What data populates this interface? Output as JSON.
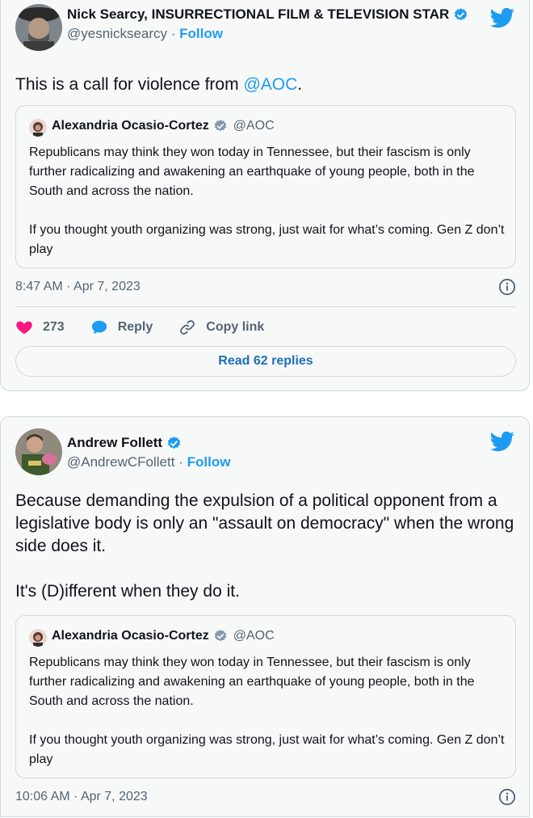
{
  "tweets": [
    {
      "author": {
        "name": "Nick Searcy, INSURRECTIONAL FILM & TELEVISION STAR",
        "handle": "@yesnicksearcy",
        "separator": "·",
        "follow": "Follow",
        "verified": true
      },
      "text_before": "This is a call for violence from ",
      "mention": "@AOC",
      "text_after": ".",
      "quote": {
        "name": "Alexandria Ocasio-Cortez",
        "handle": "@AOC",
        "text": "Republicans may think they won today in Tennessee, but their fascism is only further radicalizing and awakening an earthquake of young people, both in the South and across the nation.\n\nIf you thought youth organizing was strong, just wait for what’s coming. Gen Z don’t play"
      },
      "timestamp": "8:47 AM · Apr 7, 2023",
      "likes": "273",
      "reply_label": "Reply",
      "copy_link_label": "Copy link",
      "read_replies": "Read 62 replies"
    },
    {
      "author": {
        "name": "Andrew Follett",
        "handle": "@AndrewCFollett",
        "separator": "·",
        "follow": "Follow",
        "verified": true
      },
      "text": "Because demanding the expulsion of a political opponent from a legislative body is only an \"assault on democracy\" when the wrong side does it.\n\nIt's (D)ifferent when they do it.",
      "quote": {
        "name": "Alexandria Ocasio-Cortez",
        "handle": "@AOC",
        "text": "Republicans may think they won today in Tennessee, but their fascism is only further radicalizing and awakening an earthquake of young people, both in the South and across the nation.\n\nIf you thought youth organizing was strong, just wait for what’s coming. Gen Z don’t play"
      },
      "timestamp": "10:06 AM · Apr 7, 2023"
    }
  ],
  "colors": {
    "accent": "#1d9bf0",
    "heart": "#f91880",
    "muted": "#536471",
    "border": "#cfd9de"
  },
  "icons": [
    "twitter-bird-icon",
    "verified-badge-icon",
    "info-icon",
    "heart-icon",
    "reply-bubble-icon",
    "link-icon"
  ]
}
